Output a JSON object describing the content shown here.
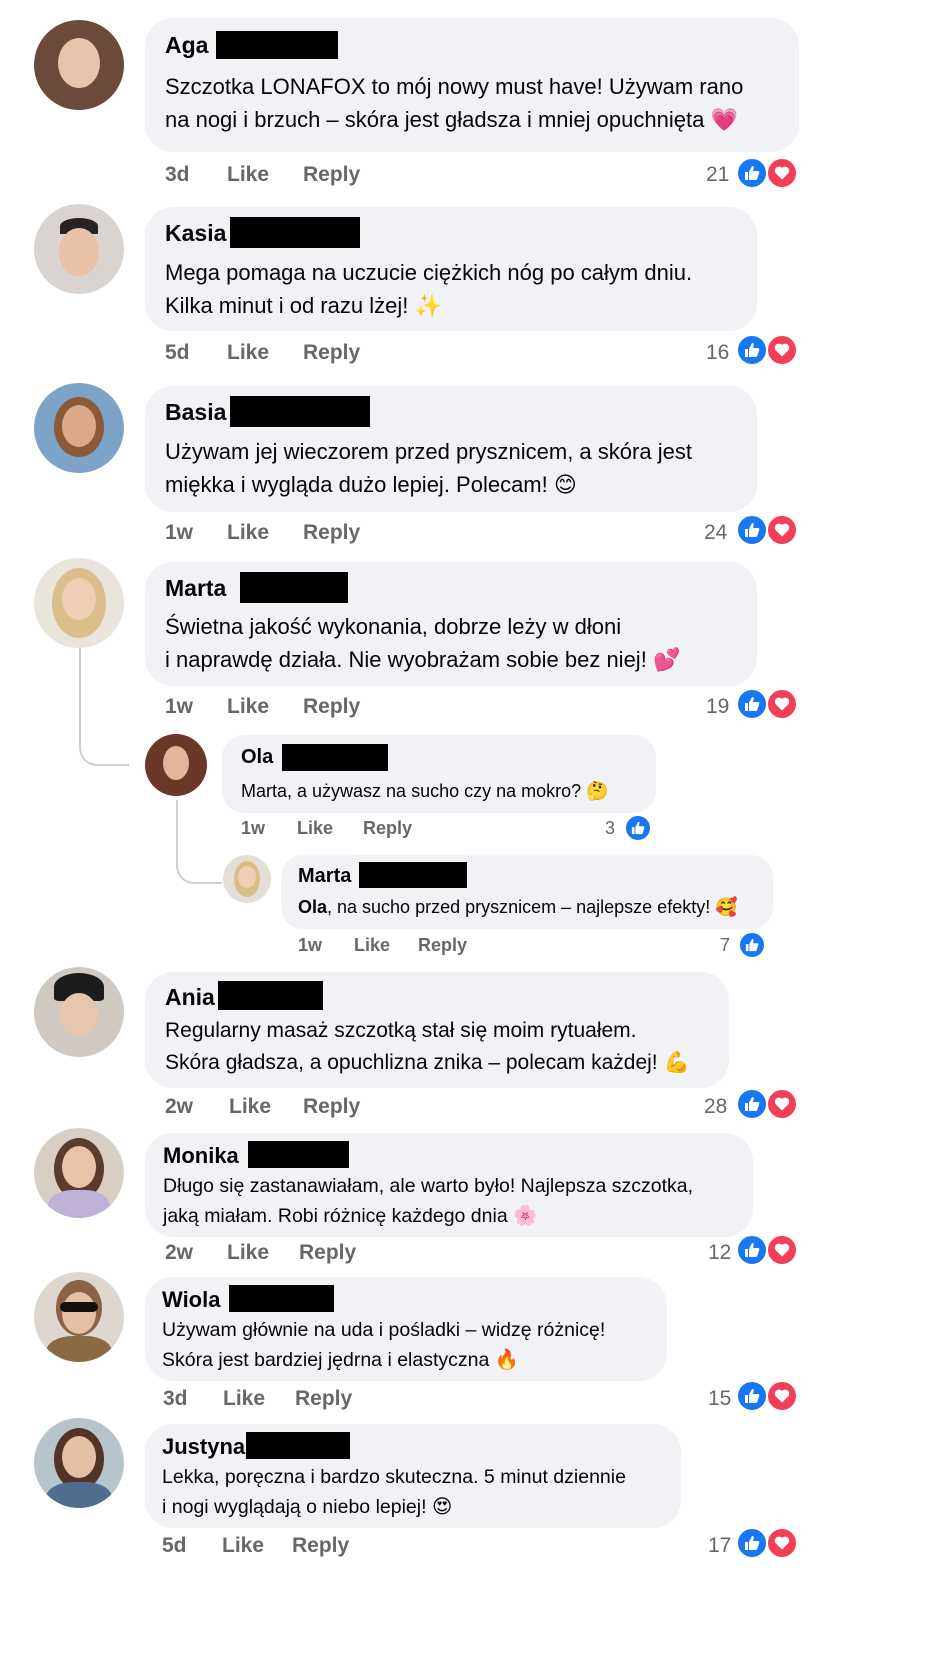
{
  "comments": [
    {
      "name": "Aga",
      "text": "Szczotka LONAFOX to mój nowy must have! Używam rano\nna nogi i brzuch – skóra jest gładsza i mniej opuchnięta",
      "emoji": "💗",
      "time": "3d",
      "like": "Like",
      "reply": "Reply",
      "count": "21"
    },
    {
      "name": "Kasia",
      "text": "Mega pomaga na uczucie ciężkich nóg po całym dniu.\nKilka minut i od razu lżej!",
      "emoji": "✨",
      "time": "5d",
      "like": "Like",
      "reply": "Reply",
      "count": "16"
    },
    {
      "name": "Basia",
      "text": "Używam jej wieczorem przed prysznicem, a skóra jest\nmiękka i wygląda dużo lepiej. Polecam!",
      "emoji": "😊",
      "time": "1w",
      "like": "Like",
      "reply": "Reply",
      "count": "24"
    },
    {
      "name": "Marta",
      "text": "Świetna jakość wykonania, dobrze leży w dłoni\ni naprawdę działa. Nie wyobrażam sobie bez niej!",
      "emoji": "💕",
      "time": "1w",
      "like": "Like",
      "reply": "Reply",
      "count": "19"
    },
    {
      "name": "Ania",
      "text": "Regularny masaż szczotką stał się moim rytuałem.\nSkóra gładsza, a opuchlizna znika – polecam każdej!",
      "emoji": "💪",
      "time": "2w",
      "like": "Like",
      "reply": "Reply",
      "count": "28"
    },
    {
      "name": "Monika",
      "text": "Długo się zastanawiałam, ale warto było! Najlepsza szczotka,\njaką miałam. Robi różnicę każdego dnia",
      "emoji": "🌸",
      "time": "2w",
      "like": "Like",
      "reply": "Reply",
      "count": "12"
    },
    {
      "name": "Wiola",
      "text": "Używam głównie na uda i pośladki – widzę różnicę!\nSkóra jest bardziej jędrna i elastyczna",
      "emoji": "🔥",
      "time": "3d",
      "like": "Like",
      "reply": "Reply",
      "count": "15"
    },
    {
      "name": "Justyna",
      "text": "Lekka, poręczna i bardzo skuteczna. 5 minut dziennie\ni nogi wyglądają o niebo lepiej!",
      "emoji": "😍",
      "time": "5d",
      "like": "Like",
      "reply": "Reply",
      "count": "17"
    }
  ],
  "replies": [
    {
      "name": "Ola",
      "text": "Marta, a używasz na sucho czy na mokro?",
      "emoji": "🤔",
      "time": "1w",
      "like": "Like",
      "reply": "Reply",
      "count": "3"
    },
    {
      "name": "Marta",
      "mention": "Ola",
      "text": ", na sucho przed prysznicem – najlepsze efekty!",
      "emoji": "🥰",
      "time": "1w",
      "like": "Like",
      "reply": "Reply",
      "count": "7"
    }
  ],
  "colors": {
    "like_blue": "#1877f2",
    "heart_red": "#f33e58",
    "bubble": "#f0f2f5",
    "meta": "#65676b"
  },
  "icons": [
    "thumbs-up-icon",
    "heart-icon"
  ]
}
